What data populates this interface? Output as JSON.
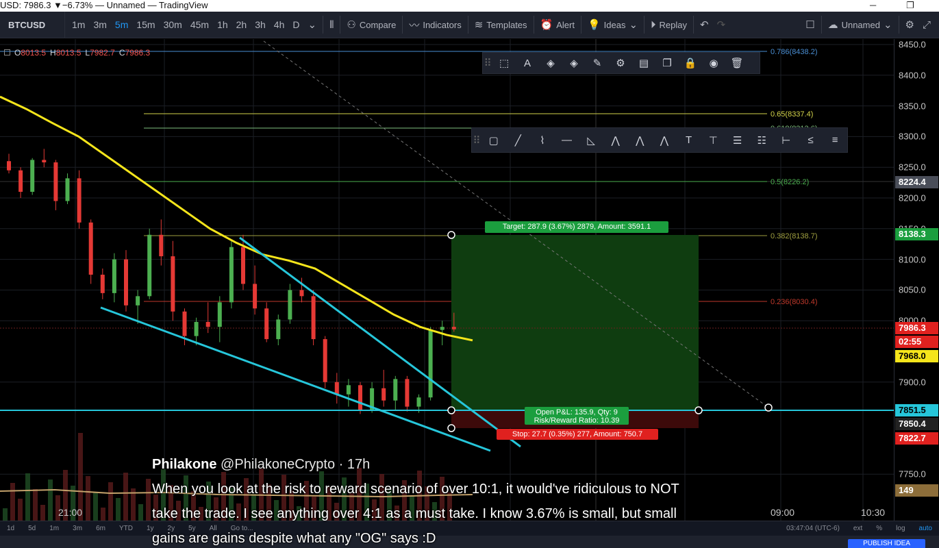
{
  "window": {
    "title": "USD: 7986.3 ▼−6.73% — Unnamed — TradingView",
    "minimize": "─",
    "maximize": "❐"
  },
  "toolbar": {
    "symbol": "BTCUSD",
    "intervals": [
      "1m",
      "3m",
      "5m",
      "15m",
      "30m",
      "45m",
      "1h",
      "2h",
      "3h",
      "4h",
      "D"
    ],
    "active_interval": "5m",
    "compare": "Compare",
    "indicators": "Indicators",
    "templates": "Templates",
    "alert": "Alert",
    "ideas": "Ideas",
    "replay": "Replay",
    "layout_name": "Unnamed"
  },
  "ohlc": {
    "o_label": "O",
    "o": "8013.5",
    "h_label": "H",
    "h": "8013.5",
    "l_label": "L",
    "l": "7982.7",
    "c_label": "C",
    "c": "7986.3"
  },
  "price_axis": {
    "ticks": [
      "8450.0",
      "8400.0",
      "8350.0",
      "8300.0",
      "8250.0",
      "8200.0",
      "8150.0",
      "8100.0",
      "8050.0",
      "8000.0",
      "7900.0",
      "7750.0"
    ],
    "labels": {
      "crosshair": "8224.4",
      "target": "8138.3",
      "last": "7986.3",
      "countdown": "02:55",
      "ma": "7968.0",
      "entry": "7851.5",
      "low": "7850.4",
      "stop": "7822.7",
      "volume": "149"
    }
  },
  "fib_levels": [
    {
      "label": "0.786(8438.2)",
      "color": "#4a8fd4"
    },
    {
      "label": "0.65(8337.4)",
      "color": "#d4d44a"
    },
    {
      "label": "0.618(8313.6)",
      "color": "#7fbf7f"
    },
    {
      "label": "0.5(8226.2)",
      "color": "#4caf50"
    },
    {
      "label": "0.382(8138.7)",
      "color": "#a0a040"
    },
    {
      "label": "0.236(8030.4)",
      "color": "#c0392b"
    }
  ],
  "position": {
    "target": "Target: 287.9 (3.67%) 2879, Amount: 3591.1",
    "pnl": "Open P&L: 135.9, Qty: 9",
    "ratio": "Risk/Reward Ratio: 10.39",
    "stop": "Stop: 27.7 (0.35%) 277, Amount: 750.7"
  },
  "time_axis": {
    "left_time": "21:00",
    "right_times": [
      "09:00",
      "10:30"
    ]
  },
  "ranges": [
    "1d",
    "5d",
    "1m",
    "3m",
    "6m",
    "YTD",
    "1y",
    "2y",
    "5y",
    "All",
    "Go to..."
  ],
  "bottom_right": {
    "clock": "03:47:04 (UTC-6)",
    "ext": "ext",
    "pct": "%",
    "log": "log",
    "auto": "auto"
  },
  "publish": "PUBLISH IDEA",
  "tweet": {
    "name": "Philakone",
    "handle": "@PhilakoneCrypto",
    "time": "· 17h",
    "text": "When you look at the risk to reward  scenario of over 10:1, it would've ridiculous to NOT\ntake the trade. I see anything over 4:1 as a must take. I know 3.67% is small, but small\ngains are gains despite what any \"OG\" says :D"
  },
  "colors": {
    "bull": "#4caf50",
    "bear": "#e53935",
    "ma": "#f5e51b",
    "trend": "#26c6da",
    "target_zone": "#0f3d10",
    "stop_zone": "#3d0a0a",
    "label_green": "#1b9e3e",
    "label_red": "#e0211f",
    "label_yellow": "#f5e51b",
    "label_blue": "#26c6da"
  },
  "chart_data": {
    "type": "line",
    "ma_series": [
      8365,
      8345,
      8322,
      8300,
      8270,
      8240,
      8210,
      8180,
      8150,
      8127,
      8108,
      8098,
      8085,
      8060,
      8035,
      8010,
      7990,
      7977,
      7968
    ],
    "candles_ohlc": [
      [
        8260,
        8272,
        8240,
        8245
      ],
      [
        8245,
        8250,
        8200,
        8210
      ],
      [
        8210,
        8265,
        8205,
        8262
      ],
      [
        8262,
        8280,
        8250,
        8258
      ],
      [
        8258,
        8262,
        8180,
        8195
      ],
      [
        8195,
        8240,
        8190,
        8232
      ],
      [
        8232,
        8245,
        8150,
        8160
      ],
      [
        8160,
        8165,
        8060,
        8075
      ],
      [
        8075,
        8085,
        8035,
        8045
      ],
      [
        8045,
        8110,
        8030,
        8100
      ],
      [
        8100,
        8115,
        8015,
        8025
      ],
      [
        8025,
        8050,
        7995,
        8040
      ],
      [
        8040,
        8150,
        8035,
        8140
      ],
      [
        8140,
        8165,
        8090,
        8105
      ],
      [
        8105,
        8130,
        8000,
        8015
      ],
      [
        8015,
        8020,
        7960,
        7975
      ],
      [
        7975,
        8005,
        7960,
        7998
      ],
      [
        7998,
        8030,
        7980,
        7990
      ],
      [
        7990,
        8040,
        7965,
        8030
      ],
      [
        8030,
        8130,
        8020,
        8120
      ],
      [
        8120,
        8140,
        8050,
        8060
      ],
      [
        8060,
        8090,
        8010,
        8020
      ],
      [
        8020,
        8030,
        7965,
        7970
      ],
      [
        7970,
        8010,
        7960,
        8002
      ],
      [
        8002,
        8060,
        7995,
        8050
      ],
      [
        8050,
        8070,
        8030,
        8040
      ],
      [
        8040,
        8050,
        7960,
        7970
      ],
      [
        7970,
        7975,
        7890,
        7900
      ],
      [
        7900,
        7915,
        7865,
        7880
      ],
      [
        7880,
        7905,
        7860,
        7895
      ],
      [
        7895,
        7900,
        7848,
        7855
      ],
      [
        7855,
        7900,
        7850,
        7890
      ],
      [
        7890,
        7920,
        7860,
        7870
      ],
      [
        7870,
        7910,
        7855,
        7905
      ],
      [
        7905,
        7910,
        7852,
        7860
      ],
      [
        7860,
        7880,
        7850,
        7875
      ],
      [
        7875,
        7990,
        7870,
        7985
      ],
      [
        7985,
        8000,
        7960,
        7990
      ],
      [
        7990,
        8013,
        7982,
        7986
      ]
    ]
  }
}
